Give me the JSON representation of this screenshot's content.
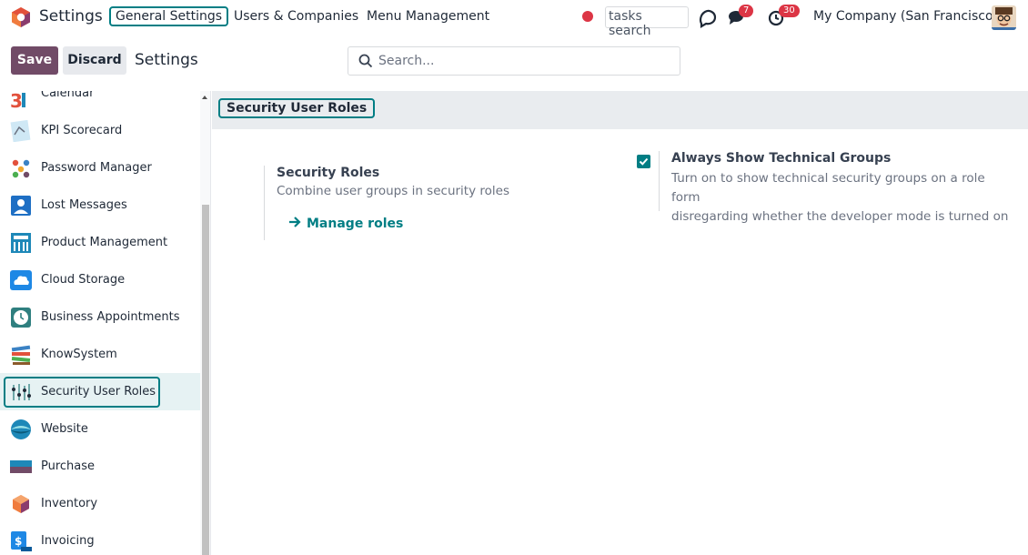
{
  "topbar": {
    "app_name": "Settings",
    "menu": [
      {
        "label": "General Settings",
        "active": true
      },
      {
        "label": "Users & Companies",
        "active": false
      },
      {
        "label": "Menu Management",
        "active": false
      }
    ],
    "tasks_search": "tasks search",
    "messages_badge": "7",
    "activities_badge": "30",
    "company": "My Company (San Francisco)"
  },
  "control": {
    "save_label": "Save",
    "discard_label": "Discard",
    "breadcrumb": "Settings",
    "search_placeholder": "Search..."
  },
  "sidebar": {
    "items": [
      {
        "label": "Calendar",
        "icon": "calendar-icon"
      },
      {
        "label": "KPI Scorecard",
        "icon": "kpi-scorecard-icon"
      },
      {
        "label": "Password Manager",
        "icon": "password-manager-icon"
      },
      {
        "label": "Lost Messages",
        "icon": "lost-messages-icon"
      },
      {
        "label": "Product Management",
        "icon": "product-management-icon"
      },
      {
        "label": "Cloud Storage",
        "icon": "cloud-storage-icon"
      },
      {
        "label": "Business Appointments",
        "icon": "business-appointments-icon"
      },
      {
        "label": "KnowSystem",
        "icon": "knowsystem-icon"
      },
      {
        "label": "Security User Roles",
        "icon": "security-user-roles-icon",
        "active": true
      },
      {
        "label": "Website",
        "icon": "website-icon"
      },
      {
        "label": "Purchase",
        "icon": "purchase-icon"
      },
      {
        "label": "Inventory",
        "icon": "inventory-icon"
      },
      {
        "label": "Invoicing",
        "icon": "invoicing-icon"
      }
    ]
  },
  "main": {
    "section_title": "Security User Roles",
    "security_roles": {
      "title": "Security Roles",
      "description": "Combine user groups in security roles",
      "link": "Manage roles"
    },
    "technical_groups": {
      "title": "Always Show Technical Groups",
      "description_line1": "Turn on to show technical security groups on a role form",
      "description_line2": "disregarding whether the developer mode is turned on",
      "checked": true
    }
  },
  "colors": {
    "brand": "#714b67",
    "accent": "#017e84",
    "badge": "#dc3545"
  }
}
